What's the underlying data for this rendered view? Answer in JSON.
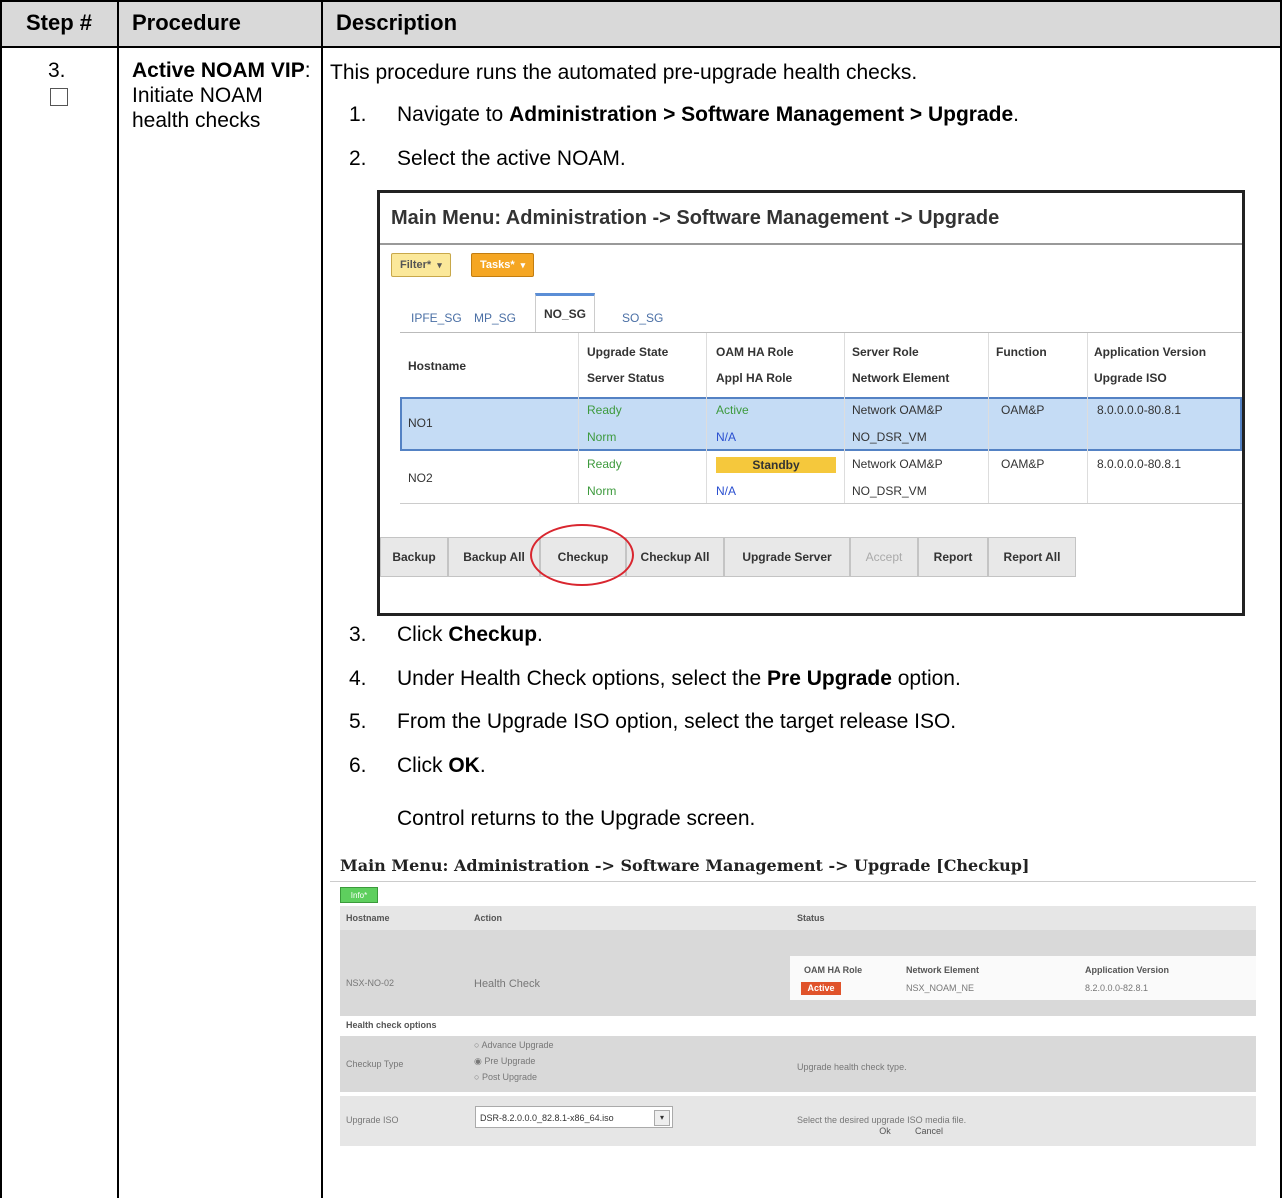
{
  "table": {
    "headers": [
      "Step #",
      "Procedure",
      "Description"
    ],
    "step_number": "3.",
    "procedure_bold": "Active NOAM VIP",
    "procedure_rest": ": Initiate NOAM health checks"
  },
  "description": {
    "intro": "This procedure runs the automated pre-upgrade health checks.",
    "steps": [
      {
        "num": "1.",
        "pre": "Navigate to ",
        "bold": "Administration > Software Management > Upgrade",
        "post": "."
      },
      {
        "num": "2.",
        "pre": "Select the active NOAM.",
        "bold": "",
        "post": ""
      },
      {
        "num": "3.",
        "pre": "Click ",
        "bold": "Checkup",
        "post": "."
      },
      {
        "num": "4.",
        "pre": "Under Health Check options, select the ",
        "bold": "Pre Upgrade",
        "post": " option."
      },
      {
        "num": "5.",
        "pre": "From the Upgrade ISO option, select the target release ISO.",
        "bold": "",
        "post": ""
      },
      {
        "num": "6.",
        "pre": "Click ",
        "bold": "OK",
        "post": "."
      }
    ],
    "note": "Control returns to the Upgrade screen."
  },
  "screenshot1": {
    "title": "Main Menu: Administration -> Software Management -> Upgrade",
    "filter_label": "Filter*",
    "tasks_label": "Tasks*",
    "tabs": [
      "IPFE_SG",
      "MP_SG",
      "NO_SG",
      "SO_SG"
    ],
    "col_headers": {
      "hostname": "Hostname",
      "upgrade_state": "Upgrade State",
      "server_status": "Server Status",
      "oam_ha_role": "OAM HA Role",
      "appl_ha_role": "Appl HA Role",
      "server_role": "Server Role",
      "network_element": "Network Element",
      "function": "Function",
      "app_version": "Application Version",
      "upgrade_iso": "Upgrade ISO"
    },
    "rows": [
      {
        "hostname": "NO1",
        "upgrade_state": "Ready",
        "server_status": "Norm",
        "oam_ha_role": "Active",
        "appl_ha_role": "N/A",
        "server_role": "Network OAM&P",
        "network_element": "NO_DSR_VM",
        "function": "OAM&P",
        "app_version": "8.0.0.0.0-80.8.1",
        "upgrade_iso": ""
      },
      {
        "hostname": "NO2",
        "upgrade_state": "Ready",
        "server_status": "Norm",
        "oam_ha_role": "Standby",
        "appl_ha_role": "N/A",
        "server_role": "Network OAM&P",
        "network_element": "NO_DSR_VM",
        "function": "OAM&P",
        "app_version": "8.0.0.0.0-80.8.1",
        "upgrade_iso": ""
      }
    ],
    "buttons": [
      "Backup",
      "Backup All",
      "Checkup",
      "Checkup All",
      "Upgrade Server",
      "Accept",
      "Report",
      "Report All"
    ]
  },
  "screenshot2": {
    "title": "Main Menu: Administration -> Software Management -> Upgrade [Checkup]",
    "info_label": "Info*",
    "headers": {
      "hostname": "Hostname",
      "action": "Action",
      "status": "Status"
    },
    "row": {
      "hostname": "NSX-NO-02",
      "action": "Health Check",
      "sub_headers": [
        "OAM HA Role",
        "Network Element",
        "Application Version"
      ],
      "oam_role": "Active",
      "network_element": "NSX_NOAM_NE",
      "app_version": "8.2.0.0.0-82.8.1"
    },
    "options_header": "Health check options",
    "checkup_type_label": "Checkup Type",
    "checkup_options": [
      "Advance Upgrade",
      "Pre Upgrade",
      "Post Upgrade"
    ],
    "checkup_help": "Upgrade health check type.",
    "upgrade_iso_label": "Upgrade ISO",
    "upgrade_iso_value": "DSR-8.2.0.0.0_82.8.1-x86_64.iso",
    "upgrade_iso_help": "Select the desired upgrade ISO media file.",
    "ok_label": "Ok",
    "cancel_label": "Cancel"
  },
  "colors": {
    "header_bg": "#d9d9d9",
    "selected_row": "#c5dcf5",
    "standby_highlight": "#f5c83c",
    "checkup_circle": "#d9262f",
    "filter_chip": "#fbe89a",
    "tasks_chip": "#f5a623",
    "info_chip": "#5ecf5e",
    "active_badge": "#e0532b"
  }
}
